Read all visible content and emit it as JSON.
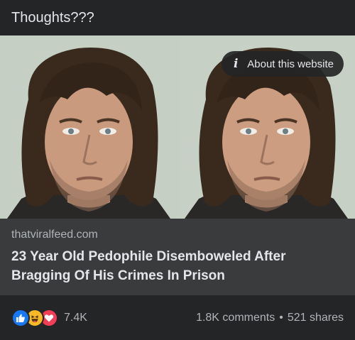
{
  "post": {
    "text": "Thoughts???"
  },
  "link_card": {
    "about_label": "About this website",
    "domain": "thatviralfeed.com",
    "headline": "23 Year Old Pedophile Disemboweled After Bragging Of His Crimes In Prison"
  },
  "stats": {
    "reaction_count": "7.4K",
    "comments": "1.8K comments",
    "separator": "•",
    "shares": "521 shares",
    "reaction_icons": [
      "like-icon",
      "haha-icon",
      "love-icon"
    ]
  },
  "colors": {
    "background": "#18191a",
    "card": "#3a3b3c",
    "text_primary": "#e4e6eb",
    "text_secondary": "#b0b3b8",
    "like": "#1877f2",
    "haha": "#f7b928",
    "love": "#f33e58"
  }
}
